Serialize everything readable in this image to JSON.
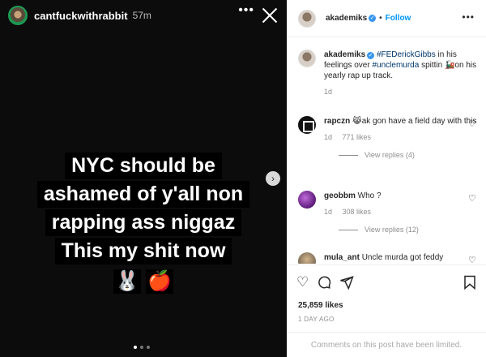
{
  "story": {
    "username": "cantfuckwithrabbit",
    "time": "57m",
    "more": "•••",
    "caption_lines": [
      "NYC should be",
      "ashamed of y'all non",
      "rapping ass niggaz",
      "This my shit now"
    ],
    "emojis": [
      "🐰",
      "🍎"
    ],
    "next_glyph": "›"
  },
  "post": {
    "header": {
      "username": "akademiks",
      "verified": "✓",
      "bullet": "•",
      "follow": "Follow",
      "more": "•••"
    },
    "caption": {
      "username": "akademiks",
      "verified": "✓",
      "text_before_tag1": " ",
      "tag1": "#FEDerickGibbs",
      "text_mid": " in his feelings over ",
      "tag2": "#unclemurda",
      "text_after": " spittin 🚂on his yearly rap up track.",
      "time": "1d"
    },
    "comments": [
      {
        "username": "rapczn",
        "text": "😹ak gon have a field day with this",
        "time": "1d",
        "likes": "771 likes",
        "replies": "View replies (4)"
      },
      {
        "username": "geobbm",
        "text": "Who ?",
        "time": "1d",
        "likes": "308 likes",
        "replies": "View replies (12)"
      },
      {
        "username": "mula_ant",
        "text": "Uncle murda got feddy"
      }
    ],
    "actions": {
      "like_icon": "heart-icon",
      "comment_icon": "comment-icon",
      "share_icon": "share-icon",
      "save_icon": "bookmark-icon"
    },
    "likes": "25,859 likes",
    "posted": "1 DAY AGO",
    "comments_limited": "Comments on this post have been limited."
  }
}
